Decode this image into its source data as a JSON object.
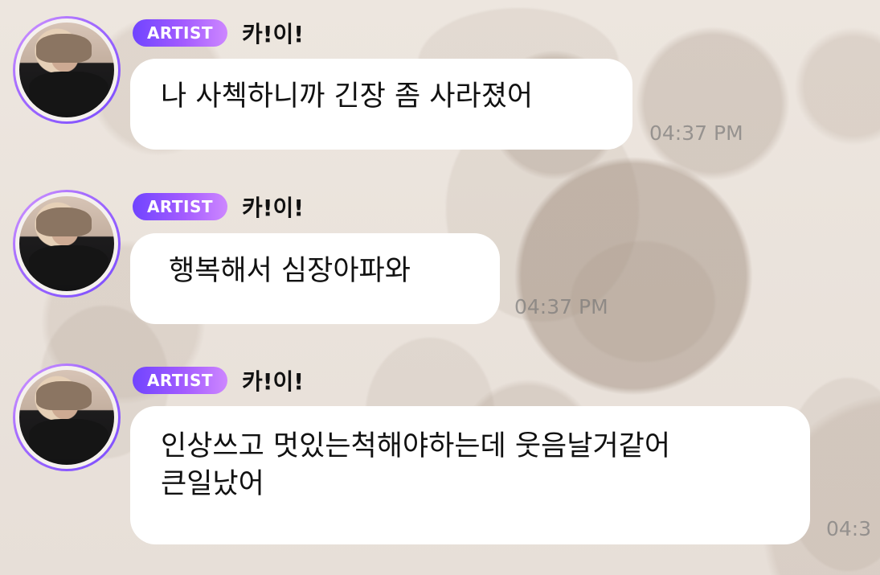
{
  "chat": {
    "messages": [
      {
        "badge": "ARTIST",
        "name": "카!이!",
        "text": "나 사첵하니까 긴장 좀 사라졌어",
        "time": "04:37 PM"
      },
      {
        "badge": "ARTIST",
        "name": "카!이!",
        "text": "행복해서 심장아파와",
        "time": "04:37 PM"
      },
      {
        "badge": "ARTIST",
        "name": "카!이!",
        "text": "인상쓰고 멋있는척해야하는데 웃음날거같어\n큰일났어",
        "time": "04:3"
      }
    ]
  }
}
